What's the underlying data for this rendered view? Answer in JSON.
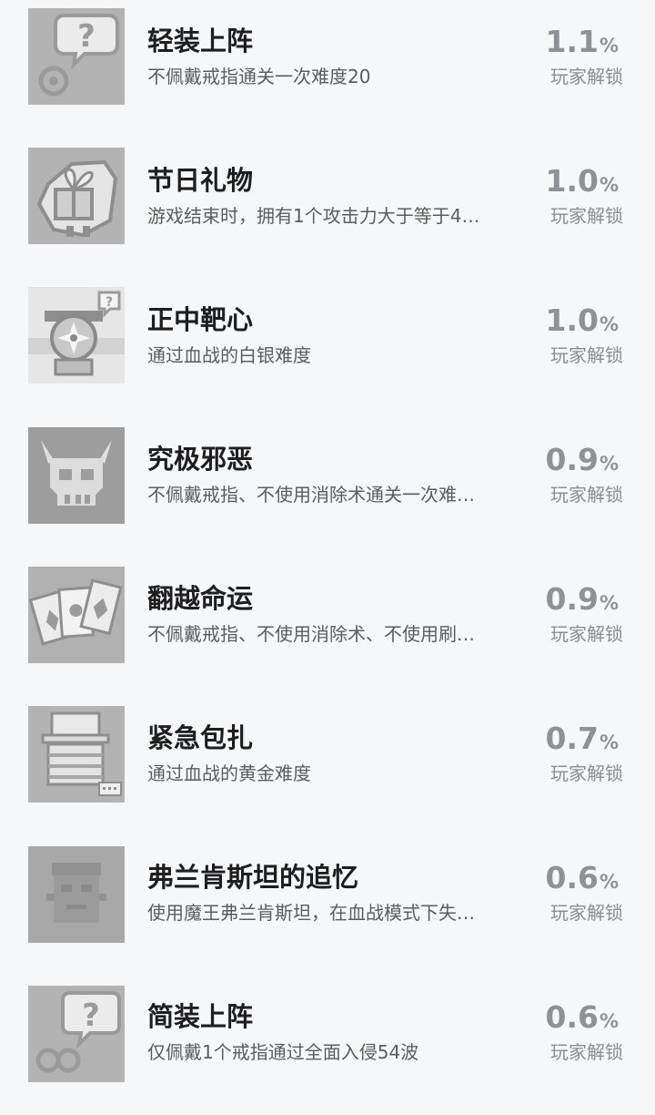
{
  "achievements": [
    {
      "title": "轻装上阵",
      "desc": "不佩戴戒指通关一次难度20",
      "pct": "1.1",
      "pct_symbol": "%",
      "unlock": "玩家解锁",
      "icon": "speech-bubble-question-icon"
    },
    {
      "title": "节日礼物",
      "desc": "游戏结束时，拥有1个攻击力大于等于4…",
      "pct": "1.0",
      "pct_symbol": "%",
      "unlock": "玩家解锁",
      "icon": "gift-icon"
    },
    {
      "title": "正中靶心",
      "desc": "通过血战的白银难度",
      "pct": "1.0",
      "pct_symbol": "%",
      "unlock": "玩家解锁",
      "icon": "bullseye-character-icon"
    },
    {
      "title": "究极邪恶",
      "desc": "不佩戴戒指、不使用消除术通关一次难…",
      "pct": "0.9",
      "pct_symbol": "%",
      "unlock": "玩家解锁",
      "icon": "horned-skull-icon"
    },
    {
      "title": "翻越命运",
      "desc": "不佩戴戒指、不使用消除术、不使用刷…",
      "pct": "0.9",
      "pct_symbol": "%",
      "unlock": "玩家解锁",
      "icon": "cards-icon"
    },
    {
      "title": "紧急包扎",
      "desc": "通过血战的黄金难度",
      "pct": "0.7",
      "pct_symbol": "%",
      "unlock": "玩家解锁",
      "icon": "bandaged-character-icon"
    },
    {
      "title": "弗兰肯斯坦的追忆",
      "desc": "使用魔王弗兰肯斯坦，在血战模式下失…",
      "pct": "0.6",
      "pct_symbol": "%",
      "unlock": "玩家解锁",
      "icon": "frankenstein-face-icon"
    },
    {
      "title": "简装上阵",
      "desc": "仅佩戴1个戒指通过全面入侵54波",
      "pct": "0.6",
      "pct_symbol": "%",
      "unlock": "玩家解锁",
      "icon": "speech-bubble-question-icon"
    }
  ]
}
